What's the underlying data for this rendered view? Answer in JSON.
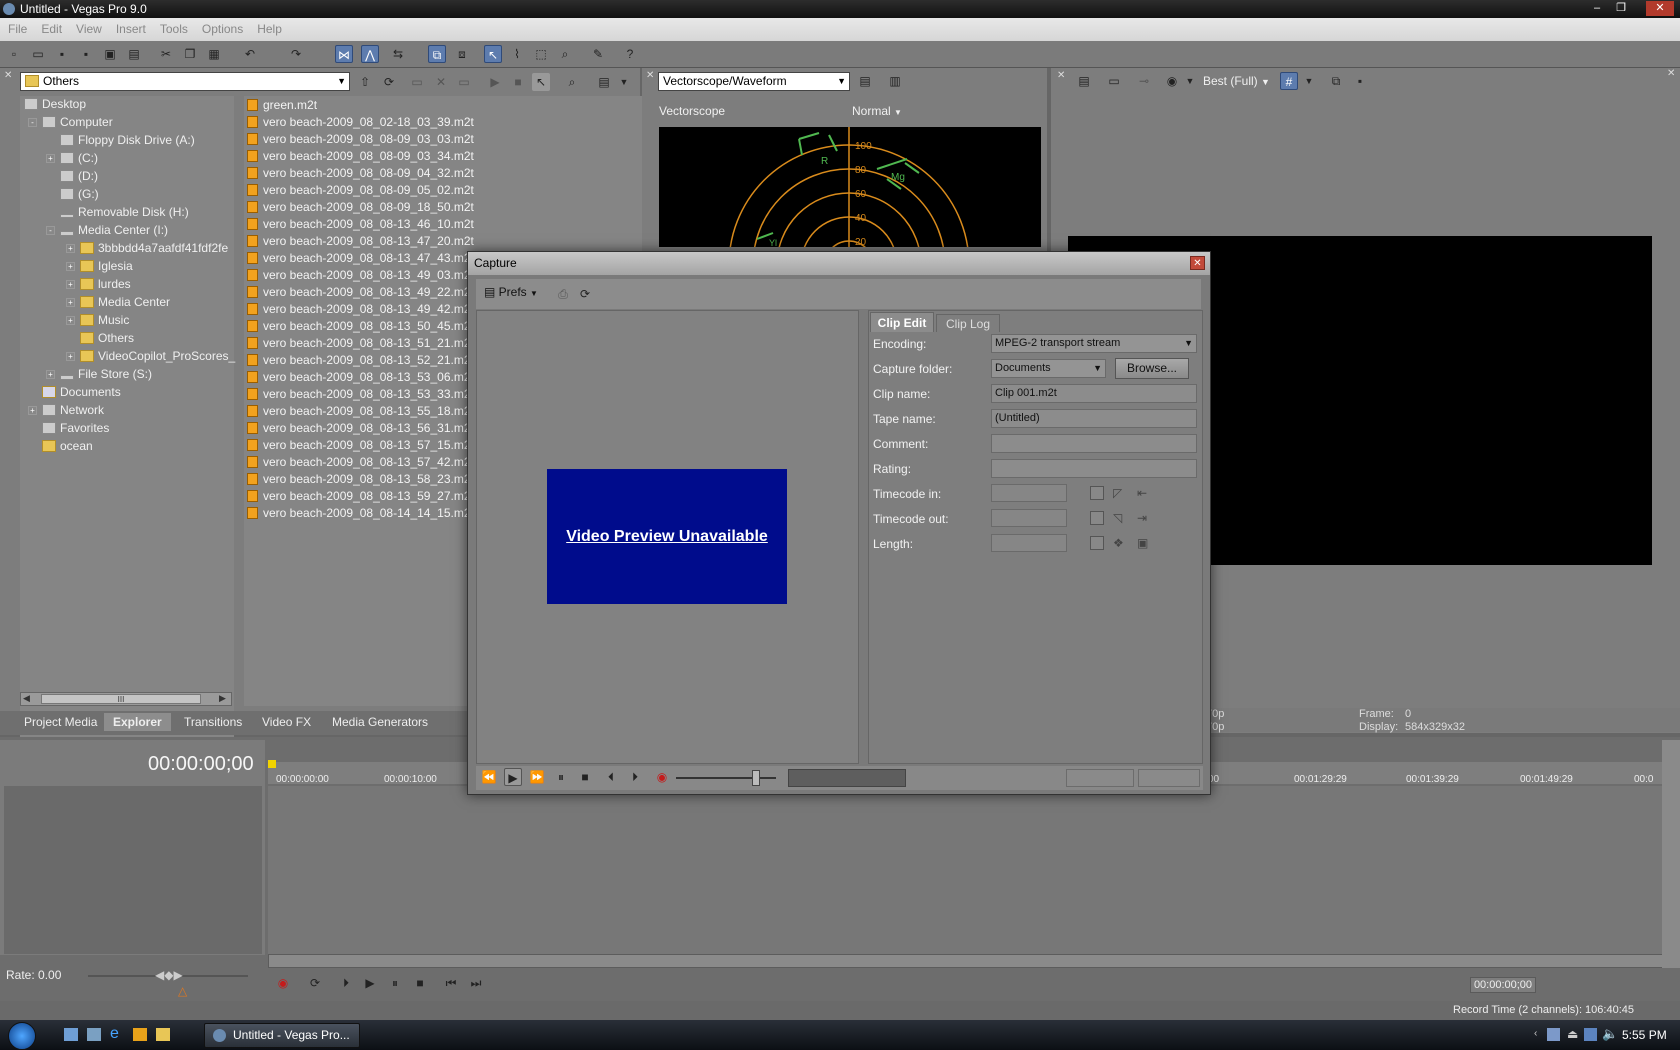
{
  "window": {
    "title": "Untitled - Vegas Pro 9.0",
    "minimize": "–",
    "restore": "❐",
    "close": "✕"
  },
  "menu": [
    "File",
    "Edit",
    "View",
    "Insert",
    "Tools",
    "Options",
    "Help"
  ],
  "explorer": {
    "location": "Others",
    "tree": [
      {
        "label": "Desktop"
      },
      {
        "label": "Computer"
      },
      {
        "label": "Floppy Disk Drive (A:)"
      },
      {
        "label": "(C:)"
      },
      {
        "label": "(D:)"
      },
      {
        "label": "(G:)"
      },
      {
        "label": "Removable Disk (H:)"
      },
      {
        "label": "Media Center (I:)"
      },
      {
        "label": "3bbbdd4a7aafdf41fdf2fe"
      },
      {
        "label": "Iglesia"
      },
      {
        "label": "lurdes"
      },
      {
        "label": "Media Center"
      },
      {
        "label": "Music"
      },
      {
        "label": "Others"
      },
      {
        "label": "VideoCopilot_ProScores_"
      },
      {
        "label": "File Store (S:)"
      },
      {
        "label": "Documents"
      },
      {
        "label": "Network"
      },
      {
        "label": "Favorites"
      },
      {
        "label": "ocean"
      }
    ],
    "files": [
      "green.m2t",
      "vero beach-2009_08_02-18_03_39.m2t",
      "vero beach-2009_08_08-09_03_03.m2t",
      "vero beach-2009_08_08-09_03_34.m2t",
      "vero beach-2009_08_08-09_04_32.m2t",
      "vero beach-2009_08_08-09_05_02.m2t",
      "vero beach-2009_08_08-09_18_50.m2t",
      "vero beach-2009_08_08-13_46_10.m2t",
      "vero beach-2009_08_08-13_47_20.m2t",
      "vero beach-2009_08_08-13_47_43.m2t",
      "vero beach-2009_08_08-13_49_03.m2t",
      "vero beach-2009_08_08-13_49_22.m2t",
      "vero beach-2009_08_08-13_49_42.m2t",
      "vero beach-2009_08_08-13_50_45.m2t",
      "vero beach-2009_08_08-13_51_21.m2t",
      "vero beach-2009_08_08-13_52_21.m2t",
      "vero beach-2009_08_08-13_53_06.m2t",
      "vero beach-2009_08_08-13_53_33.m2t",
      "vero beach-2009_08_08-13_55_18.m2t",
      "vero beach-2009_08_08-13_56_31.m2t",
      "vero beach-2009_08_08-13_57_15.m2t",
      "vero beach-2009_08_08-13_57_42.m2t",
      "vero beach-2009_08_08-13_58_23.m2t",
      "vero beach-2009_08_08-13_59_27.m2t",
      "vero beach-2009_08_08-14_14_15.m2t"
    ],
    "hscroll_grip": "III"
  },
  "window_tabs": [
    "Project Media",
    "Explorer",
    "Transitions",
    "Video FX",
    "Media Generators"
  ],
  "scopes": {
    "mode_select": "Vectorscope/Waveform",
    "scope_label": "Vectorscope",
    "view_select": "Normal",
    "ticks": [
      "100",
      "80",
      "60",
      "40",
      "20"
    ],
    "targets": [
      "R",
      "Mg",
      "Yl"
    ]
  },
  "preview": {
    "quality": "Best (Full)",
    "info_left": [
      "70p",
      "70p"
    ],
    "frame_label": "Frame:",
    "frame_value": "0",
    "display_label": "Display:",
    "display_value": "584x329x32"
  },
  "timeline": {
    "timecode": "00:00:00;00",
    "ruler_left": [
      "00:00:00:00",
      "00:00:10:00"
    ],
    "ruler_right": [
      "00",
      "00:01:29:29",
      "00:01:39:29",
      "00:01:49:29",
      "00:0"
    ],
    "rate_label": "Rate: 0.00",
    "end_timecode": "00:00:00;00",
    "record_time": "Record Time (2 channels): 106:40:45"
  },
  "capture": {
    "title": "Capture",
    "prefs": "Prefs",
    "preview_text": "Video Preview Unavailable",
    "tabs": [
      "Clip Edit",
      "Clip Log"
    ],
    "encoding_label": "Encoding:",
    "encoding_value": "MPEG-2 transport stream",
    "folder_label": "Capture folder:",
    "folder_value": "Documents",
    "browse": "Browse...",
    "clipname_label": "Clip name:",
    "clipname_value": "Clip 001.m2t",
    "tapename_label": "Tape name:",
    "tapename_value": "(Untitled)",
    "comment_label": "Comment:",
    "rating_label": "Rating:",
    "tcin_label": "Timecode in:",
    "tcout_label": "Timecode out:",
    "length_label": "Length:"
  },
  "taskbar": {
    "task": "Untitled - Vegas Pro...",
    "clock": "5:55 PM"
  },
  "colors": {
    "preview_unavailable": "#000c8c",
    "scope_trace": "#d98b1c",
    "selected_tool": "#5d7cae"
  }
}
